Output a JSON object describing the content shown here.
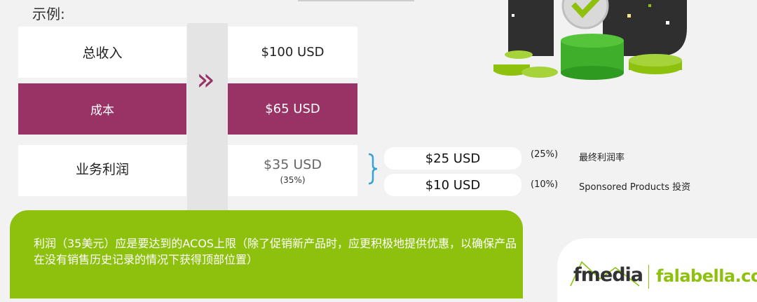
{
  "example_label": "示例:",
  "table": {
    "row1": {
      "label": "总收入",
      "value": "$100 USD"
    },
    "row2": {
      "label": "成本",
      "value": "$65 USD"
    },
    "row3": {
      "label": "业务利润",
      "value": "$35 USD",
      "percent": "(35%)"
    }
  },
  "arrow_glyph": "»",
  "breakdown": [
    {
      "value": "$25 USD",
      "percent": "(25%)",
      "desc": "最终利润率"
    },
    {
      "value": "$10 USD",
      "percent": "(10%)",
      "desc": "Sponsored Products 投资"
    }
  ],
  "callout_text": "利润（35美元）应是要达到的ACOS上限（除了促销新产品时，应更积极地提供优惠，以确保产品在没有销售历史记录的情况下获得顶部位置）",
  "logos": {
    "fmedia": "fmedia",
    "falabella": "falabella.com"
  },
  "colors": {
    "purple": "#993366",
    "green": "#8dc10e",
    "bracket": "#3aa0d8"
  }
}
